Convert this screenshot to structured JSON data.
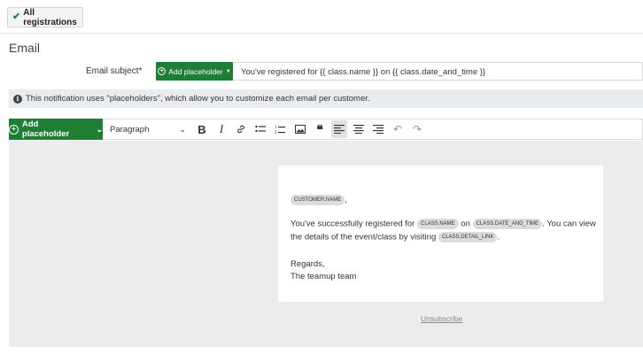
{
  "top_button": {
    "label": "All registrations",
    "icon": "checkmark-icon",
    "accent": "#1f8a2f"
  },
  "section": {
    "title": "Email"
  },
  "subject": {
    "label": "Email subject*",
    "placeholder_button": "Add placeholder",
    "value": "You've registered for {{ class.name }} on {{ class.date_and_time }}"
  },
  "notice": {
    "text": "This notification uses \"placeholders\", which allow you to customize each email per customer."
  },
  "toolbar": {
    "placeholder_button": "Add placeholder",
    "format_select": "Paragraph",
    "icons": [
      "bold-icon",
      "italic-icon",
      "link-icon",
      "bullet-list-icon",
      "numbered-list-icon",
      "image-icon",
      "quote-icon",
      "align-left-icon",
      "align-center-icon",
      "align-right-icon",
      "undo-icon",
      "redo-icon"
    ]
  },
  "email": {
    "greeting_tag": "CUSTOMER.NAME",
    "greeting_suffix": ",",
    "line1_prefix": "You've successfully registered for",
    "tag_class_name": "CLASS.NAME",
    "line1_on": "on",
    "tag_date_time": "CLASS.DATE_AND_TIME",
    "line1_suffix": ". You can view",
    "line2_prefix": "the details of the event/class by visiting",
    "tag_detail_link": "CLASS.DETAIL_LINK",
    "line2_suffix": ".",
    "regards": "Regards,",
    "signature": "The teamup team"
  },
  "footer": {
    "unsubscribe": "Unsubscribe"
  },
  "colors": {
    "primary_green": "#1e7e34",
    "notice_bg": "#e9ecef",
    "editor_bg": "#ececec"
  }
}
